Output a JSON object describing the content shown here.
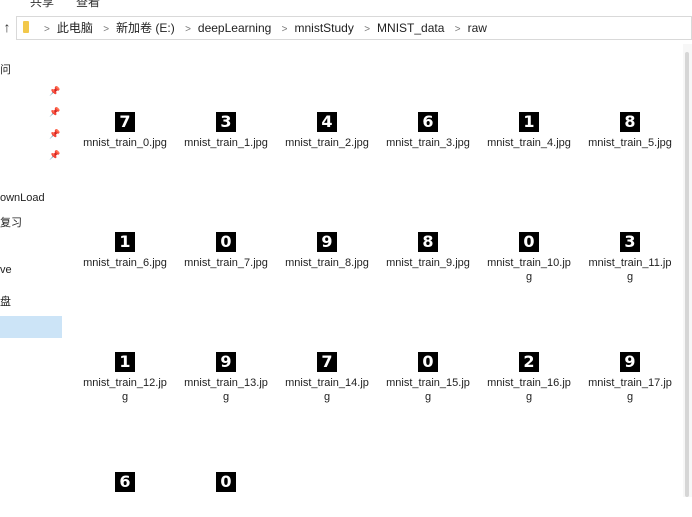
{
  "ribbon": {
    "tab_share": "共享",
    "tab_view": "查看"
  },
  "address": {
    "crumbs": [
      "此电脑",
      "新加卷 (E:)",
      "deepLearning",
      "mnistStudy",
      "MNIST_data",
      "raw"
    ]
  },
  "sidebar": {
    "items": [
      {
        "label": "问"
      },
      {
        "label": "ownLoad"
      },
      {
        "label": "复习"
      },
      {
        "label": "ve"
      },
      {
        "label": "盘"
      }
    ]
  },
  "files": [
    {
      "digit": "7",
      "name": "mnist_train_0.jpg"
    },
    {
      "digit": "3",
      "name": "mnist_train_1.jpg"
    },
    {
      "digit": "4",
      "name": "mnist_train_2.jpg"
    },
    {
      "digit": "6",
      "name": "mnist_train_3.jpg"
    },
    {
      "digit": "1",
      "name": "mnist_train_4.jpg"
    },
    {
      "digit": "8",
      "name": "mnist_train_5.jpg"
    },
    {
      "digit": "1",
      "name": "mnist_train_6.jpg"
    },
    {
      "digit": "0",
      "name": "mnist_train_7.jpg"
    },
    {
      "digit": "9",
      "name": "mnist_train_8.jpg"
    },
    {
      "digit": "8",
      "name": "mnist_train_9.jpg"
    },
    {
      "digit": "0",
      "name": "mnist_train_10.jpg"
    },
    {
      "digit": "3",
      "name": "mnist_train_11.jpg"
    },
    {
      "digit": "1",
      "name": "mnist_train_12.jpg"
    },
    {
      "digit": "9",
      "name": "mnist_train_13.jpg"
    },
    {
      "digit": "7",
      "name": "mnist_train_14.jpg"
    },
    {
      "digit": "0",
      "name": "mnist_train_15.jpg"
    },
    {
      "digit": "2",
      "name": "mnist_train_16.jpg"
    },
    {
      "digit": "9",
      "name": "mnist_train_17.jpg"
    },
    {
      "digit": "6",
      "name": ""
    },
    {
      "digit": "0",
      "name": ""
    }
  ]
}
